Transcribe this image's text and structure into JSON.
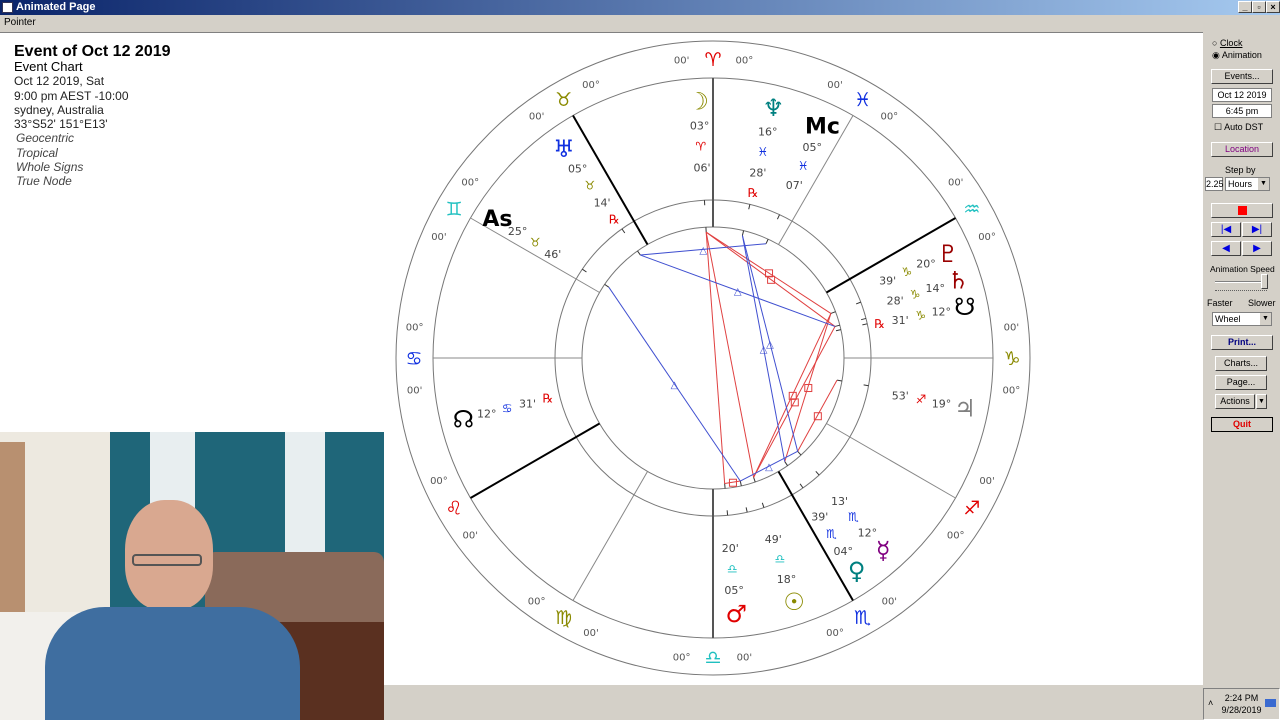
{
  "window": {
    "title": "Animated Page",
    "menu": "Pointer",
    "controls": [
      "_",
      "▫",
      "×"
    ]
  },
  "info": {
    "title": "Event of Oct 12 2019",
    "subtitle": "Event Chart",
    "date": "Oct 12 2019, Sat",
    "time": "9:00 pm  AEST -10:00",
    "place": "sydney, Australia",
    "coords": "33°S52' 151°E13'",
    "opts": [
      "Geocentric",
      "Tropical",
      "Whole Signs",
      "True Node"
    ]
  },
  "panel": {
    "clock": "Clock",
    "animation": "Animation",
    "mode_selected": "Animation",
    "events": "Events...",
    "date": "Oct 12 2019",
    "time": "6:45 pm",
    "autodst": "Auto DST",
    "autodst_checked": false,
    "location": "Location",
    "stepby": "Step by",
    "step_value": "2.25",
    "step_unit": "Hours",
    "stop_color": "#ff0000",
    "anim_speed": "Animation Speed",
    "speed_level": 1.0,
    "faster": "Faster",
    "slower": "Slower",
    "view": "Wheel",
    "print": "Print...",
    "charts": "Charts...",
    "page": "Page...",
    "actions": "Actions",
    "quit": "Quit"
  },
  "taskbar": {
    "time": "2:24 PM",
    "date": "9/28/2019"
  },
  "chart": {
    "signs": [
      {
        "name": "Aries",
        "glyph": "♈",
        "color": "#e00000"
      },
      {
        "name": "Taurus",
        "glyph": "♉",
        "color": "#8a8a00"
      },
      {
        "name": "Gemini",
        "glyph": "♊",
        "color": "#20c0c0"
      },
      {
        "name": "Cancer",
        "glyph": "♋",
        "color": "#1030e0"
      },
      {
        "name": "Leo",
        "glyph": "♌",
        "color": "#e00000"
      },
      {
        "name": "Virgo",
        "glyph": "♍",
        "color": "#8a8a00"
      },
      {
        "name": "Libra",
        "glyph": "♎",
        "color": "#20c0c0"
      },
      {
        "name": "Scorpio",
        "glyph": "♏",
        "color": "#1030e0"
      },
      {
        "name": "Sagittarius",
        "glyph": "♐",
        "color": "#e00000"
      },
      {
        "name": "Capricorn",
        "glyph": "♑",
        "color": "#8a8a00"
      },
      {
        "name": "Aquarius",
        "glyph": "♒",
        "color": "#20c0c0"
      },
      {
        "name": "Pisces",
        "glyph": "♓",
        "color": "#1030e0"
      }
    ],
    "cusp_deg": "00°",
    "cusp_min": "00'",
    "points": [
      {
        "id": "moon",
        "glyph": "☽",
        "color": "#8a8a00",
        "deg": "03°",
        "sign": "♈",
        "sign_color": "#e00000",
        "min": "06'",
        "retro": false,
        "lon": 3.1
      },
      {
        "id": "neptune",
        "glyph": "♆",
        "color": "#008080",
        "deg": "16°",
        "sign": "♓",
        "sign_color": "#1030e0",
        "min": "28'",
        "retro": true,
        "lon": 346.5
      },
      {
        "id": "mc",
        "glyph": "Mc",
        "color": "#000000",
        "deg": "05°",
        "sign": "♓",
        "sign_color": "#1030e0",
        "min": "07'",
        "retro": false,
        "lon": 335.1
      },
      {
        "id": "uranus",
        "glyph": "♅",
        "color": "#1030e0",
        "deg": "05°",
        "sign": "♉",
        "sign_color": "#8a8a00",
        "min": "14'",
        "retro": true,
        "lon": 35.2
      },
      {
        "id": "ascendant",
        "glyph": "As",
        "color": "#000000",
        "deg": "25°",
        "sign": "♉",
        "sign_color": "#8a8a00",
        "min": "46'",
        "retro": false,
        "lon": 55.8
      },
      {
        "id": "pluto",
        "glyph": "♇",
        "color": "#9a0000",
        "deg": "20°",
        "sign": "♑",
        "sign_color": "#8a8a00",
        "min": "39'",
        "retro": false,
        "lon": 290.7
      },
      {
        "id": "saturn",
        "glyph": "♄",
        "color": "#9a0000",
        "deg": "14°",
        "sign": "♑",
        "sign_color": "#8a8a00",
        "min": "28'",
        "retro": false,
        "lon": 284.5
      },
      {
        "id": "south-node",
        "glyph": "☋",
        "color": "#000000",
        "deg": "12°",
        "sign": "♑",
        "sign_color": "#8a8a00",
        "min": "31'",
        "retro": true,
        "lon": 282.5
      },
      {
        "id": "jupiter",
        "glyph": "♃",
        "color": "#808080",
        "deg": "19°",
        "sign": "♐",
        "sign_color": "#e00000",
        "min": "53'",
        "retro": false,
        "lon": 259.9
      },
      {
        "id": "mercury",
        "glyph": "☿",
        "color": "#800080",
        "deg": "12°",
        "sign": "♏",
        "sign_color": "#1030e0",
        "min": "13'",
        "retro": false,
        "lon": 222.2
      },
      {
        "id": "venus",
        "glyph": "♀",
        "color": "#008080",
        "deg": "04°",
        "sign": "♏",
        "sign_color": "#1030e0",
        "min": "39'",
        "retro": false,
        "lon": 214.7
      },
      {
        "id": "sun",
        "glyph": "☉",
        "color": "#8a8a00",
        "deg": "18°",
        "sign": "♎",
        "sign_color": "#20c0c0",
        "min": "49'",
        "retro": false,
        "lon": 198.8
      },
      {
        "id": "mars",
        "glyph": "♂",
        "color": "#e00000",
        "deg": "05°",
        "sign": "♎",
        "sign_color": "#20c0c0",
        "min": "20'",
        "retro": false,
        "lon": 185.3
      },
      {
        "id": "north-node",
        "glyph": "☊",
        "color": "#000000",
        "deg": "12°",
        "sign": "♋",
        "sign_color": "#1030e0",
        "min": "31'",
        "retro": true,
        "lon": 192.5
      }
    ],
    "retro_symbol": "℞",
    "retro_color": "#e00000",
    "aspects": [
      {
        "a": "sun",
        "b": "saturn",
        "type": "square"
      },
      {
        "a": "sun",
        "b": "pluto",
        "type": "square"
      },
      {
        "a": "sun",
        "b": "moon",
        "type": "opposition"
      },
      {
        "a": "mars",
        "b": "moon",
        "type": "opposition"
      },
      {
        "a": "moon",
        "b": "pluto",
        "type": "square"
      },
      {
        "a": "moon",
        "b": "saturn",
        "type": "square"
      },
      {
        "a": "mercury",
        "b": "jupiter",
        "type": "square"
      },
      {
        "a": "venus",
        "b": "pluto",
        "type": "square"
      },
      {
        "a": "north-node",
        "b": "mars",
        "type": "square"
      },
      {
        "a": "uranus",
        "b": "saturn",
        "type": "trine"
      },
      {
        "a": "neptune",
        "b": "mercury",
        "type": "trine"
      },
      {
        "a": "neptune",
        "b": "venus",
        "type": "trine"
      },
      {
        "a": "north-node",
        "b": "mercury",
        "type": "trine"
      },
      {
        "a": "uranus",
        "b": "mc",
        "type": "trine"
      },
      {
        "a": "north-node",
        "b": "ascendant",
        "type": "trine"
      }
    ],
    "aspect_colors": {
      "square": "#e04040",
      "opposition": "#e04040",
      "trine": "#4050d0"
    }
  }
}
